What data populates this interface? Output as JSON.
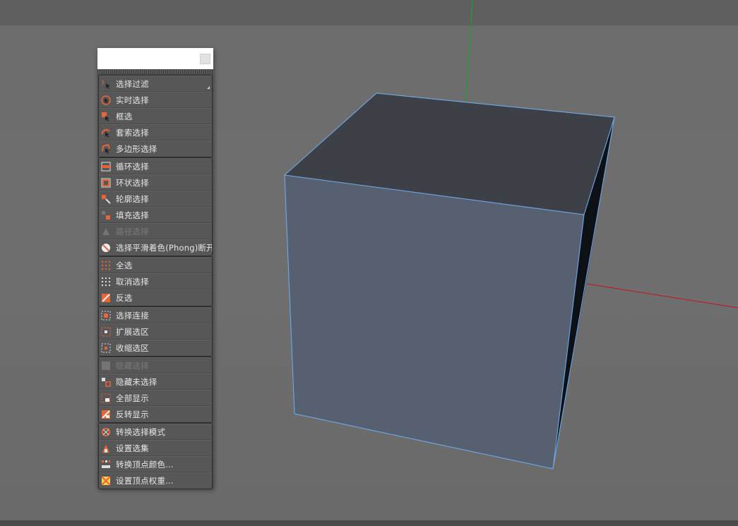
{
  "scene": {
    "object": "cube",
    "axis_colors": {
      "x": "#c0151c",
      "y": "#1e9e2a"
    },
    "edge_color": "#6fa8e8",
    "face_colors": {
      "top": "#3d4046",
      "front": "#576170",
      "side": "#0d1014"
    }
  },
  "menu": {
    "groups": [
      {
        "items": [
          {
            "label": "选择过滤",
            "icon": "filter-icon",
            "has_submenu": true
          },
          {
            "label": "实时选择",
            "icon": "live-select-icon"
          },
          {
            "label": "框选",
            "icon": "box-select-icon"
          },
          {
            "label": "套索选择",
            "icon": "lasso-select-icon"
          },
          {
            "label": "多边形选择",
            "icon": "polygon-select-icon"
          }
        ]
      },
      {
        "items": [
          {
            "label": "循环选择",
            "icon": "loop-select-icon"
          },
          {
            "label": "环状选择",
            "icon": "ring-select-icon"
          },
          {
            "label": "轮廓选择",
            "icon": "outline-select-icon"
          },
          {
            "label": "填充选择",
            "icon": "fill-select-icon"
          },
          {
            "label": "路径选择",
            "icon": "path-select-icon",
            "disabled": true
          },
          {
            "label": "选择平滑着色(Phong)断开",
            "icon": "phong-break-icon"
          }
        ]
      },
      {
        "items": [
          {
            "label": "全选",
            "icon": "select-all-icon"
          },
          {
            "label": "取消选择",
            "icon": "deselect-icon"
          },
          {
            "label": "反选",
            "icon": "invert-select-icon"
          }
        ]
      },
      {
        "items": [
          {
            "label": "选择连接",
            "icon": "select-connected-icon"
          },
          {
            "label": "扩展选区",
            "icon": "grow-selection-icon"
          },
          {
            "label": "收缩选区",
            "icon": "shrink-selection-icon"
          }
        ]
      },
      {
        "items": [
          {
            "label": "隐藏选择",
            "icon": "hide-selected-icon",
            "disabled": true
          },
          {
            "label": "隐藏未选择",
            "icon": "hide-unselected-icon"
          },
          {
            "label": "全部显示",
            "icon": "unhide-all-icon"
          },
          {
            "label": "反转显示",
            "icon": "invert-visibility-icon"
          }
        ]
      },
      {
        "items": [
          {
            "label": "转换选择模式",
            "icon": "convert-selection-icon"
          },
          {
            "label": "设置选集",
            "icon": "set-selection-icon"
          },
          {
            "label": "转换顶点颜色...",
            "icon": "convert-vertex-color-icon"
          },
          {
            "label": "设置顶点权重...",
            "icon": "set-vertex-weight-icon"
          }
        ]
      }
    ]
  }
}
